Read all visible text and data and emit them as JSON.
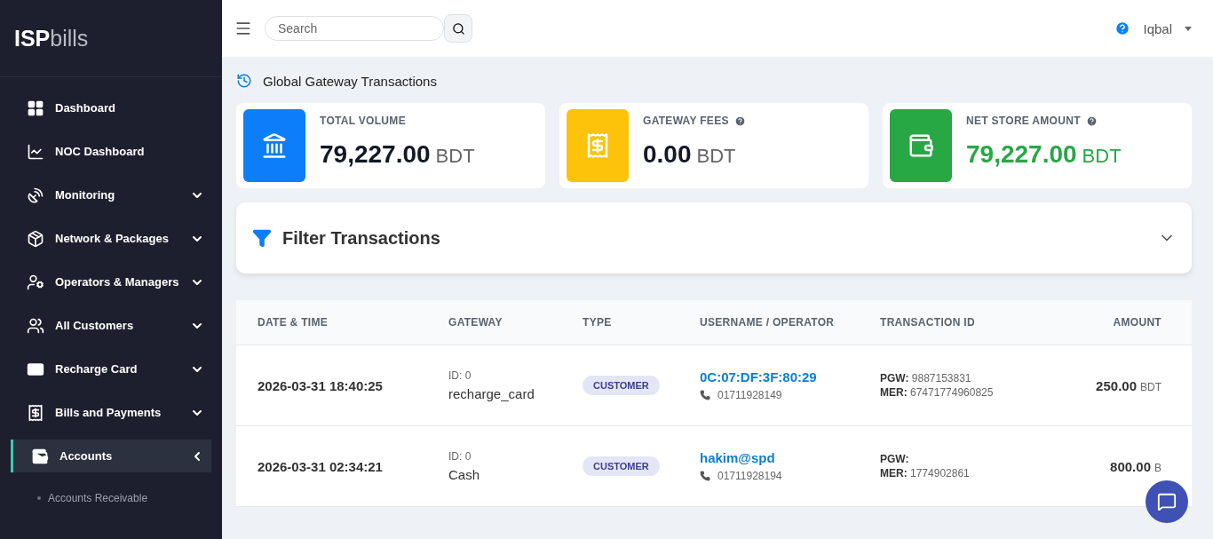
{
  "logo": {
    "strong": "ISP",
    "light": "bills"
  },
  "sidebar": {
    "items": [
      {
        "label": "Dashboard",
        "kind": "link",
        "selected": false
      },
      {
        "label": "NOC Dashboard",
        "kind": "link",
        "selected": false
      },
      {
        "label": "Monitoring",
        "kind": "menu",
        "selected": false,
        "expanded": false
      },
      {
        "label": "Network & Packages",
        "kind": "menu",
        "selected": false,
        "expanded": false
      },
      {
        "label": "Operators & Managers",
        "kind": "menu",
        "selected": false,
        "expanded": false
      },
      {
        "label": "All Customers",
        "kind": "menu",
        "selected": false,
        "expanded": false
      },
      {
        "label": "Recharge Card",
        "kind": "menu",
        "selected": false,
        "expanded": false
      },
      {
        "label": "Bills and Payments",
        "kind": "menu",
        "selected": false,
        "expanded": false
      },
      {
        "label": "Accounts",
        "kind": "menu",
        "selected": true,
        "expanded": true,
        "children": [
          {
            "label": "Accounts Receivable"
          }
        ]
      }
    ]
  },
  "topbar": {
    "search": {
      "placeholder": "Search"
    },
    "user": "Iqbal"
  },
  "page_title": "Global Gateway Transactions",
  "stats": [
    {
      "label": "TOTAL VOLUME",
      "value": "79,227.00",
      "unit": "BDT",
      "color": "#0d7ef9",
      "info": false,
      "highlight": false
    },
    {
      "label": "GATEWAY FEES",
      "value": "0.00",
      "unit": "BDT",
      "color": "#fdc30a",
      "info": true,
      "highlight": false
    },
    {
      "label": "NET STORE AMOUNT",
      "value": "79,227.00",
      "unit": "BDT",
      "color": "#28a745",
      "info": true,
      "highlight": true
    }
  ],
  "filter": {
    "title": "Filter Transactions",
    "expanded": false
  },
  "table": {
    "columns": [
      "DATE & TIME",
      "GATEWAY",
      "TYPE",
      "USERNAME / OPERATOR",
      "TRANSACTION ID",
      "AMOUNT"
    ],
    "rows": [
      {
        "datetime": "2026-03-31 18:40:25",
        "gateway_id": "ID: 0",
        "gateway": "recharge_card",
        "type": "CUSTOMER",
        "username": "0C:07:DF:3F:80:29",
        "phone": "01711928149",
        "pgw_label": "PGW:",
        "pgw": "9887153831",
        "mer_label": "MER:",
        "mer": "67471774960825",
        "amount": "250.00",
        "unit": "BDT"
      },
      {
        "datetime": "2026-03-31 02:34:21",
        "gateway_id": "ID: 0",
        "gateway": "Cash",
        "type": "CUSTOMER",
        "username": "hakim@spd",
        "phone": "01711928194",
        "pgw_label": "PGW:",
        "mer_label": "MER:",
        "mer": "1774902861",
        "amount": "800.00",
        "unit": "B"
      }
    ]
  }
}
